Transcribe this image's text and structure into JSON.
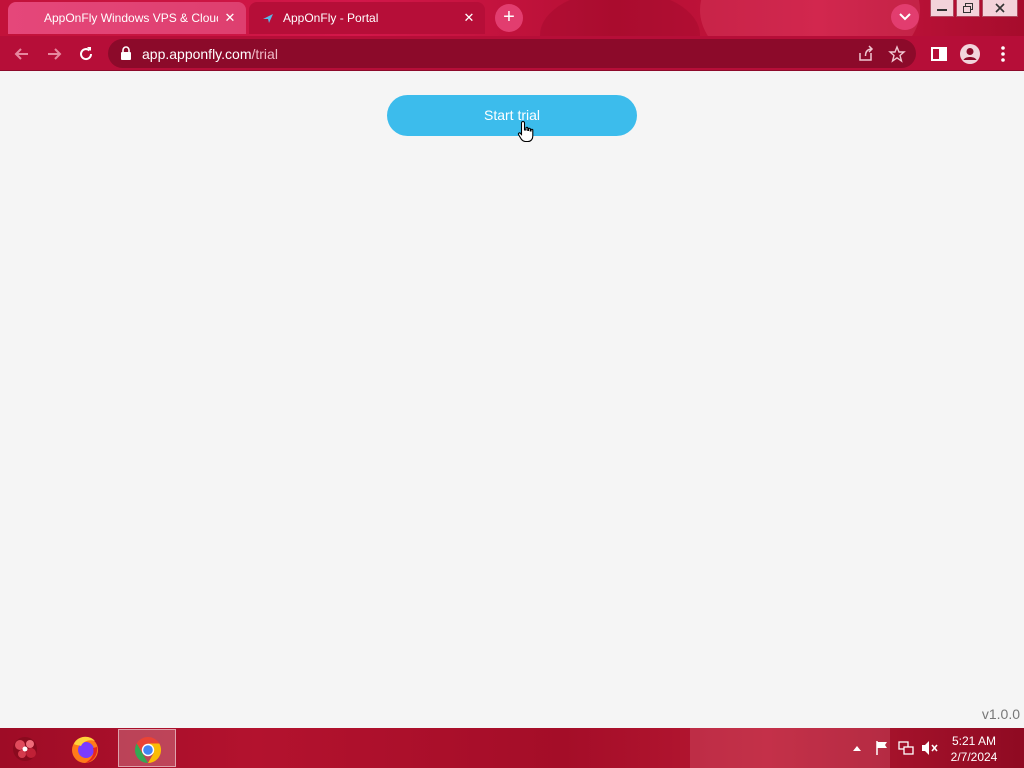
{
  "browser": {
    "tabs": [
      {
        "title": "AppOnFly Windows VPS & Cloud Desktop",
        "state": "inactive"
      },
      {
        "title": "AppOnFly - Portal",
        "state": "active"
      }
    ],
    "address_bar": {
      "domain": "app.apponfly.com",
      "path": "/trial"
    }
  },
  "page": {
    "start_button_label": "Start trial",
    "version": "v1.0.0"
  },
  "taskbar": {
    "apps": [
      "firefox-icon",
      "chrome-icon"
    ],
    "clock": {
      "time": "5:21 AM",
      "date": "2/7/2024"
    }
  },
  "colors": {
    "browser_frame": "#b60e38",
    "button_accent": "#3cbcec",
    "page_background": "#f5f5f5"
  }
}
